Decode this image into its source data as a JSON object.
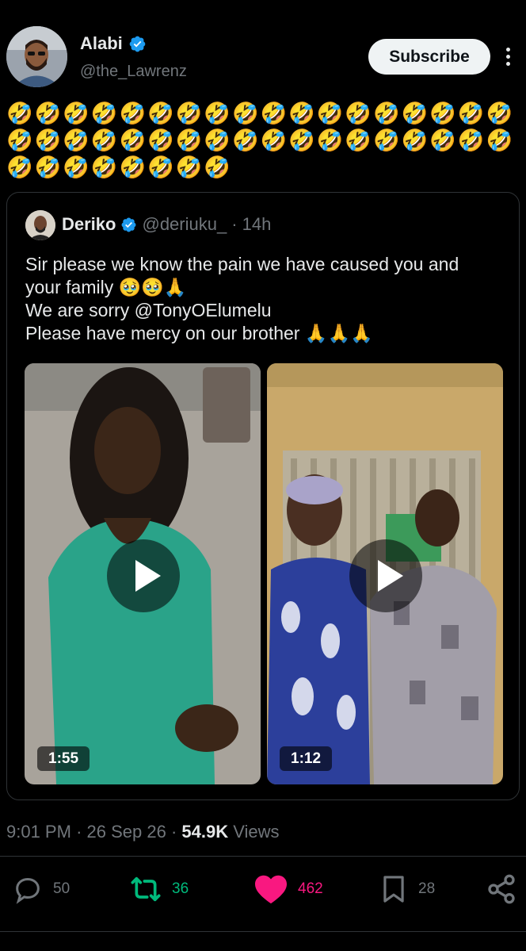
{
  "author": {
    "name": "Alabi",
    "handle": "@the_Lawrenz"
  },
  "subscribe_label": "Subscribe",
  "post_text": "🤣🤣🤣🤣🤣🤣🤣🤣🤣🤣🤣🤣🤣🤣🤣🤣🤣🤣🤣🤣🤣🤣🤣🤣🤣🤣🤣🤣🤣🤣🤣🤣🤣🤣🤣🤣🤣🤣🤣🤣🤣🤣🤣🤣",
  "quoted": {
    "name": "Deriko",
    "handle": "@deriuku_",
    "time": "· 14h",
    "lines": [
      "Sir please we know the pain we have caused you and",
      "your family 🥹🥹🙏",
      "We are sorry @TonyOElumelu",
      "Please have mercy on our brother 🙏🙏🙏"
    ],
    "videos": [
      {
        "duration": "1:55"
      },
      {
        "duration": "1:12"
      }
    ]
  },
  "meta": {
    "time": "9:01 PM",
    "date": "26 Sep 26",
    "views_count": "54.9K",
    "views_label": "Views"
  },
  "actions": {
    "replies": "50",
    "reposts": "36",
    "likes": "462",
    "bookmarks": "28"
  },
  "colors": {
    "background": "#000000",
    "verified": "#1d9bf0",
    "repost": "#00ba7c",
    "like": "#f91880",
    "muted": "#71767b"
  }
}
